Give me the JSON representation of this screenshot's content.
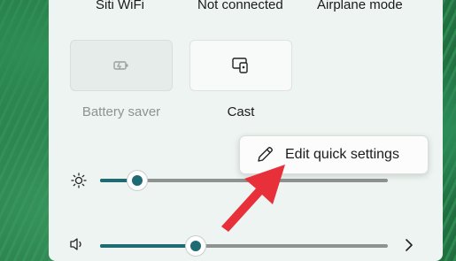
{
  "top_labels": {
    "wifi": "Siti WiFi",
    "bluetooth": "Not connected",
    "airplane": "Airplane mode"
  },
  "tiles": {
    "battery_saver": {
      "label": "Battery saver",
      "icon": "battery-saver-icon",
      "state": "disabled"
    },
    "cast": {
      "label": "Cast",
      "icon": "cast-icon",
      "state": "enabled"
    }
  },
  "popup": {
    "label": "Edit quick settings",
    "icon": "pencil-icon"
  },
  "brightness": {
    "icon": "sun-icon",
    "level": 0.13
  },
  "volume": {
    "icon": "speaker-icon",
    "level": 0.33
  },
  "colors": {
    "accent": "#1e6b74",
    "arrow": "#e8303a",
    "panel": "#eef4f1"
  }
}
